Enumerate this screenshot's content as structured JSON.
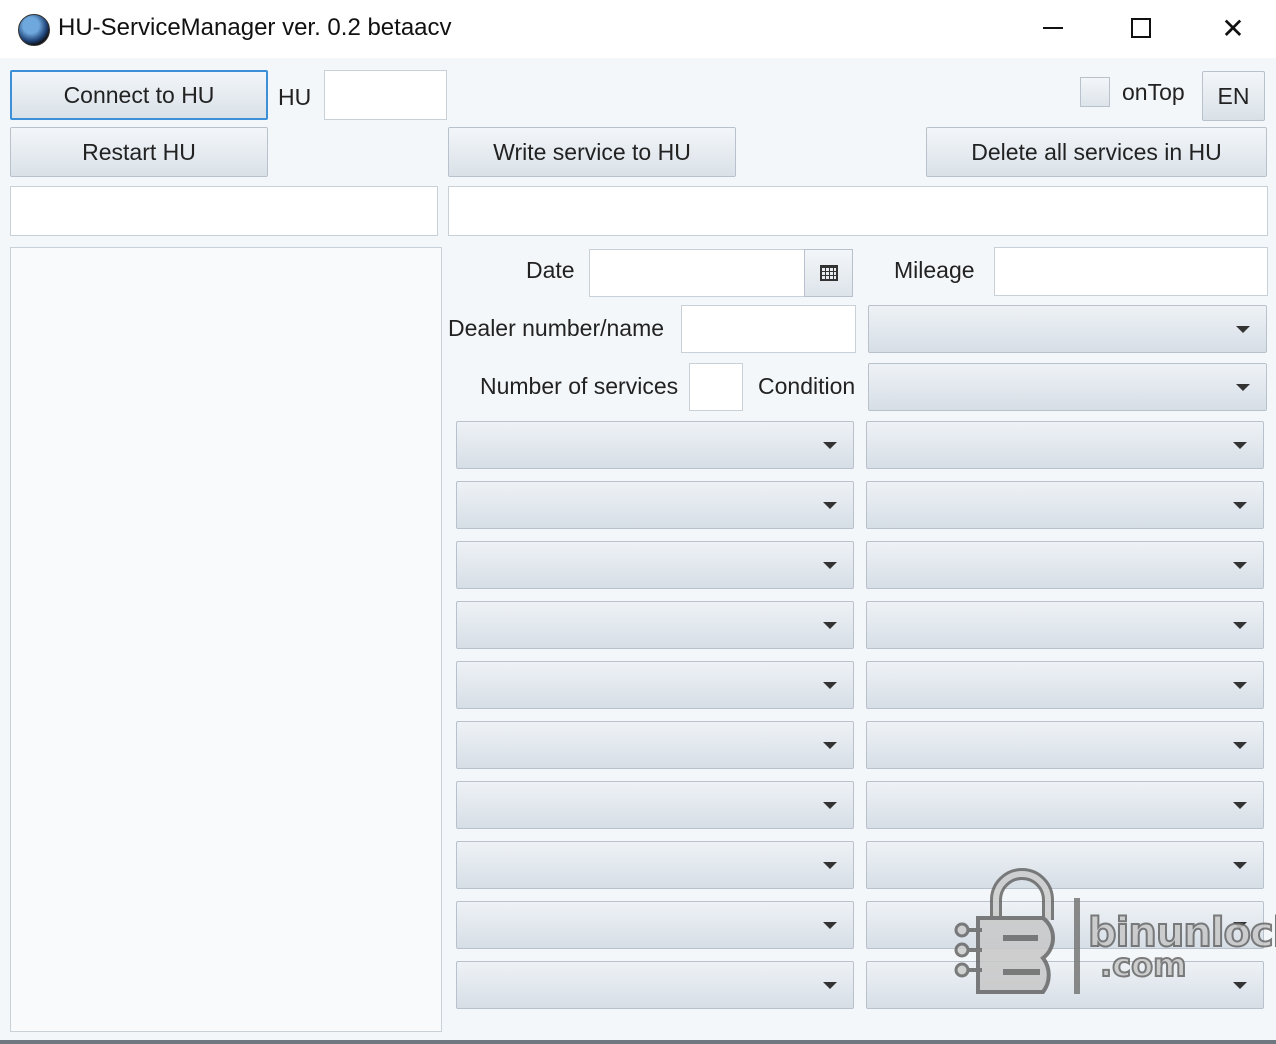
{
  "window": {
    "title": "HU-ServiceManager ver. 0.2 betaacv",
    "icon": "bmw-logo-icon",
    "controls": [
      "minimize-icon",
      "maximize-icon",
      "close-icon"
    ]
  },
  "toolbar": {
    "connect_label": "Connect to HU",
    "hu_label": "HU",
    "hu_value": "",
    "ontop_label": "onTop",
    "ontop_checked": false,
    "lang_label": "EN",
    "restart_label": "Restart HU",
    "write_label": "Write service to HU",
    "delete_label": "Delete all services in HU"
  },
  "status": {
    "left_value": "",
    "right_value": ""
  },
  "form": {
    "date_label": "Date",
    "date_value": "",
    "mileage_label": "Mileage",
    "mileage_value": "",
    "dealer_label": "Dealer number/name",
    "dealer_value": "",
    "services_count_label": "Number of services",
    "services_count_value": "",
    "condition_label": "Condition",
    "condition_value": "",
    "dealer_select_value": ""
  },
  "service_rows": [
    {
      "left": "",
      "right": ""
    },
    {
      "left": "",
      "right": ""
    },
    {
      "left": "",
      "right": ""
    },
    {
      "left": "",
      "right": ""
    },
    {
      "left": "",
      "right": ""
    },
    {
      "left": "",
      "right": ""
    },
    {
      "left": "",
      "right": ""
    },
    {
      "left": "",
      "right": ""
    },
    {
      "left": "",
      "right": ""
    },
    {
      "left": "",
      "right": ""
    }
  ],
  "watermark": {
    "line1": "binunlock",
    "line2": ".com",
    "icon": "padlock-b-logo-icon"
  }
}
